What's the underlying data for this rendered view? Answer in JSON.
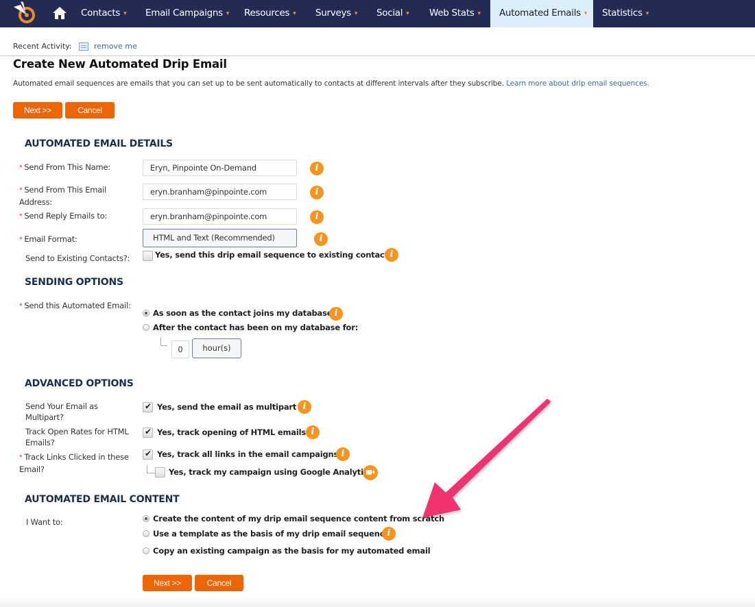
{
  "nav": {
    "logo_icon": "target-logo-icon",
    "home_icon": "home-icon",
    "items": [
      {
        "label": "Contacts",
        "active": false
      },
      {
        "label": "Email Campaigns",
        "active": false
      },
      {
        "label": "Resources",
        "active": false
      },
      {
        "label": "Surveys",
        "active": false
      },
      {
        "label": "Social",
        "active": false
      },
      {
        "label": "Web Stats",
        "active": false
      },
      {
        "label": "Automated Emails",
        "active": true
      },
      {
        "label": "Statistics",
        "active": false
      }
    ],
    "caret": "▾"
  },
  "recent_activity": {
    "label": "Recent Activity:",
    "link": "remove me"
  },
  "page": {
    "title": "Create New Automated Drip Email",
    "intro": "Automated email sequences are emails that you can set up to be sent automatically to contacts at different intervals after they subscribe.",
    "intro_link": "Learn more about drip email sequences."
  },
  "buttons": {
    "next": "Next >>",
    "cancel": "Cancel"
  },
  "details": {
    "title": "AUTOMATED EMAIL DETAILS",
    "from_name_label": "Send From This Name:",
    "from_name_value": "Eryn, Pinpointe On-Demand",
    "from_email_label": "Send From This Email Address:",
    "from_email_value": "eryn.branham@pinpointe.com",
    "reply_label": "Send Reply Emails to:",
    "reply_value": "eryn.branham@pinpointe.com",
    "format_label": "Email Format:",
    "format_value": "HTML and Text (Recommended)",
    "existing_label": "Send to Existing Contacts?:",
    "existing_option": "Yes, send this drip email sequence to existing contacts",
    "existing_checked": false
  },
  "sending": {
    "title": "SENDING OPTIONS",
    "label": "Send this Automated Email:",
    "option_immediate": "As soon as the contact joins my database",
    "option_after": "After the contact has been on my database for:",
    "selected": "immediate",
    "delay_value": "0",
    "delay_unit": "hour(s)"
  },
  "advanced": {
    "title": "ADVANCED OPTIONS",
    "multipart_label": "Send Your Email as Multipart?",
    "multipart_option": "Yes, send the email as multipart",
    "multipart_checked": true,
    "open_label": "Track Open Rates for HTML Emails?",
    "open_option": "Yes, track opening of HTML emails",
    "open_checked": true,
    "links_label": "Track Links Clicked in these Email?",
    "links_option": "Yes, track all links in the email campaigns",
    "links_checked": true,
    "ga_option": "Yes, track my campaign using Google Analytics",
    "ga_checked": false
  },
  "content": {
    "title": "AUTOMATED EMAIL CONTENT",
    "label": "I Want to:",
    "options": [
      "Create the content of my drip email sequence content from scratch",
      "Use a template as the basis of my drip email sequence",
      "Copy an existing campaign as the basis for my automated email"
    ],
    "selected_index": 0
  },
  "annotation": {
    "arrow_color": "#f0336e"
  },
  "required_mark": "*",
  "info_glyph": "i"
}
